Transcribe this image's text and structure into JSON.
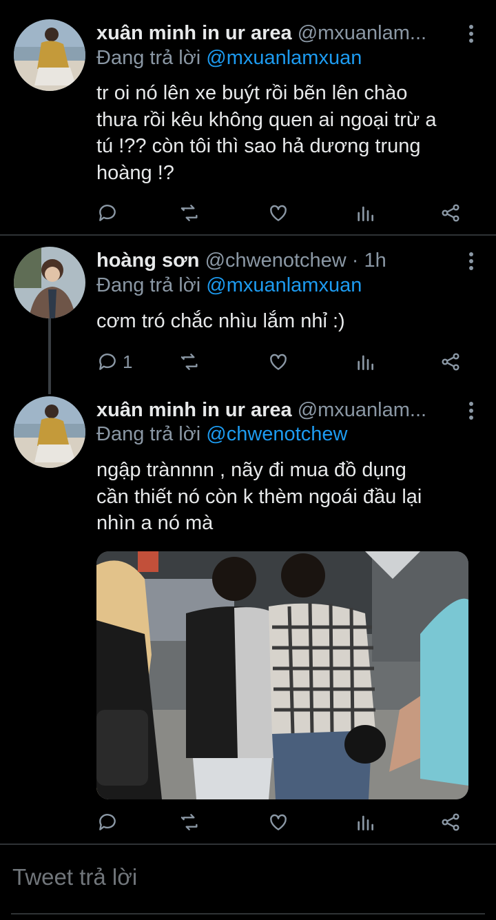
{
  "tweets": [
    {
      "name": "xuân minh in ur area",
      "handle": "@mxuanlam...",
      "replying_prefix": "Đang trả lời ",
      "replying_to": "@mxuanlamxuan",
      "lines": [
        "tr oi nó lên xe buýt rồi bẽn lên chào",
        "thưa rồi kêu không quen ai ngoại trừ a",
        "tú !?? còn tôi thì sao hả dương trung",
        "hoàng !?"
      ],
      "reply_count": ""
    },
    {
      "name": "hoàng sơn",
      "handle": "@chwenotchew · 1h",
      "replying_prefix": "Đang trả lời ",
      "replying_to": "@mxuanlamxuan",
      "lines": [
        "cơm tró chắc nhìu lắm nhỉ :)"
      ],
      "reply_count": "1"
    },
    {
      "name": "xuân minh in ur area",
      "handle": "@mxuanlam...",
      "replying_prefix": "Đang trả lời ",
      "replying_to": "@chwenotchew",
      "lines": [
        "ngập trànnnn , nãy đi mua đồ dụng",
        "cần thiết nó còn k thèm ngoái đầu lại",
        "nhìn a nó mà"
      ],
      "reply_count": ""
    }
  ],
  "media": {
    "subject": "photo-of-people-walking-on-street"
  },
  "reply_box": {
    "placeholder": "Tweet trả lời"
  },
  "icons": [
    "reply-icon",
    "retweet-icon",
    "like-icon",
    "analytics-icon",
    "share-icon",
    "more-icon"
  ],
  "colors": {
    "background": "#000000",
    "text": "#e7e9ea",
    "muted": "#8b98a5",
    "link": "#1d9bf0",
    "divider": "#2f3336"
  }
}
